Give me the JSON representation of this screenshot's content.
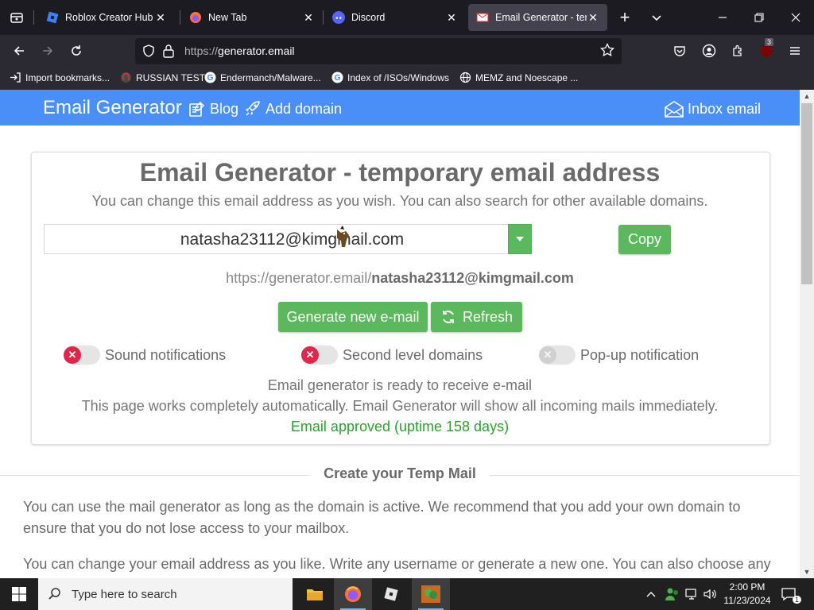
{
  "browser": {
    "tabs": [
      {
        "label": "Roblox Creator Hub",
        "active": false
      },
      {
        "label": "New Tab",
        "active": false
      },
      {
        "label": "Discord",
        "active": false
      },
      {
        "label": "Email Generator - temp",
        "active": true
      }
    ],
    "url_protocol": "https://",
    "url_host": "generator.email",
    "extension_badge": "3",
    "bookmarks": [
      "Import bookmarks...",
      "RUSSIAN TEST",
      "Endermanch/Malware...",
      "Index of /ISOs/Windows",
      "MEMZ and Noescape ..."
    ]
  },
  "site": {
    "brand": "Email Generator",
    "nav": {
      "blog": "Blog",
      "add_domain": "Add domain",
      "inbox": "Inbox email"
    },
    "accent_color": "#4a8ff7",
    "button_color": "#5cb85c"
  },
  "generator": {
    "title": "Email Generator - temporary email address",
    "subtitle": "You can change this email address as you wish. You can also search for other available domains.",
    "email_value": "natasha23112@kimgmail.com",
    "copy_label": "Copy",
    "url_prefix": "https://generator.email/",
    "url_address": "natasha23112@kimgmail.com",
    "generate_label": "Generate new e-mail",
    "refresh_label": "Refresh",
    "toggles": [
      {
        "label": "Sound notifications",
        "state": "off"
      },
      {
        "label": "Second level domains",
        "state": "off"
      },
      {
        "label": "Pop-up notification",
        "state": "off"
      }
    ],
    "status_ready": "Email generator is ready to receive e-mail",
    "status_auto": "This page works completely automatically. Email Generator will show all incoming mails immediately.",
    "status_approved": "Email approved (uptime 158 days)"
  },
  "section": {
    "title": "Create your Temp Mail",
    "para1": "You can use the mail generator as long as the domain is active. We recommend that you add your own domain to ensure that you do not lose access to your mailbox.",
    "para2": "You can change your email address as you like. Write any username or generate a new one. You can also choose any"
  },
  "taskbar": {
    "search_placeholder": "Type here to search",
    "time": "2:00 PM",
    "date": "11/23/2024",
    "notification_count": "1"
  }
}
